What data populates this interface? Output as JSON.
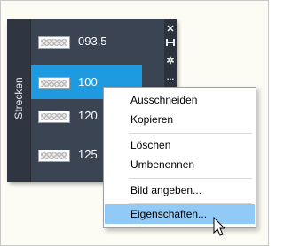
{
  "palette": {
    "tab_label": "Strecken",
    "rail_icons": [
      "close-icon",
      "pin-icon",
      "settings-icon"
    ],
    "items": [
      {
        "label": "093,5",
        "selected": false
      },
      {
        "label": "100",
        "selected": true
      },
      {
        "label": "120",
        "selected": false
      },
      {
        "label": "125",
        "selected": false
      }
    ]
  },
  "context_menu": {
    "items": [
      {
        "label": "Ausschneiden"
      },
      {
        "label": "Kopieren"
      },
      {
        "label": "Löschen"
      },
      {
        "label": "Umbenennen"
      },
      {
        "label": "Bild angeben..."
      },
      {
        "label": "Eigenschaften...",
        "hovered": true
      }
    ]
  },
  "colors": {
    "palette_bg": "#3b4453",
    "selected_bg": "#1e9be0",
    "menu_hover": "#91c9f7"
  }
}
